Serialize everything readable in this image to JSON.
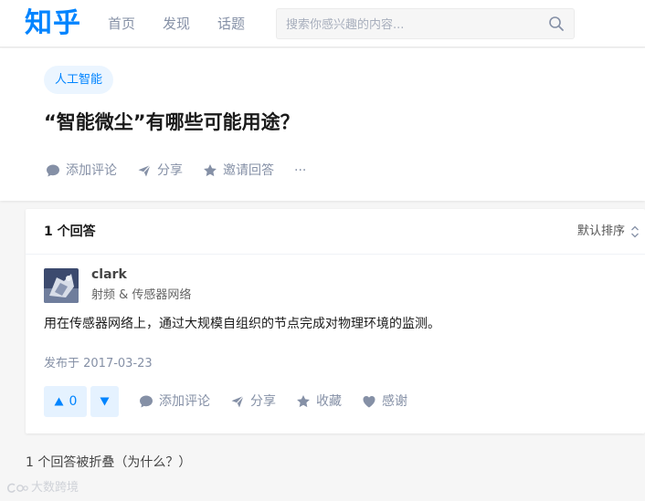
{
  "header": {
    "logo": "知乎",
    "nav": [
      "首页",
      "发现",
      "话题"
    ],
    "search_placeholder": "搜索你感兴趣的内容..."
  },
  "question": {
    "topic": "人工智能",
    "title": "“智能微尘”有哪些可能用途？",
    "actions": {
      "comment": "添加评论",
      "share": "分享",
      "invite": "邀请回答",
      "more": "···"
    }
  },
  "answers": {
    "count_label": "1 个回答",
    "sort_label": "默认排序",
    "item": {
      "author": "clark",
      "bio": "射频 & 传感器网络",
      "content": "用在传感器网络上，通过大规模自组织的节点完成对物理环境的监测。",
      "date": "发布于 2017-03-23",
      "upvotes": "0",
      "actions": {
        "comment": "添加评论",
        "share": "分享",
        "collect": "收藏",
        "thanks": "感谢"
      }
    }
  },
  "collapsed_label": "1 个回答被折叠（为什么？）",
  "watermark": "大数跨境",
  "colors": {
    "brand": "#0084ff",
    "secondary_text": "#8590a6",
    "vote_bg": "#e5f2ff"
  }
}
